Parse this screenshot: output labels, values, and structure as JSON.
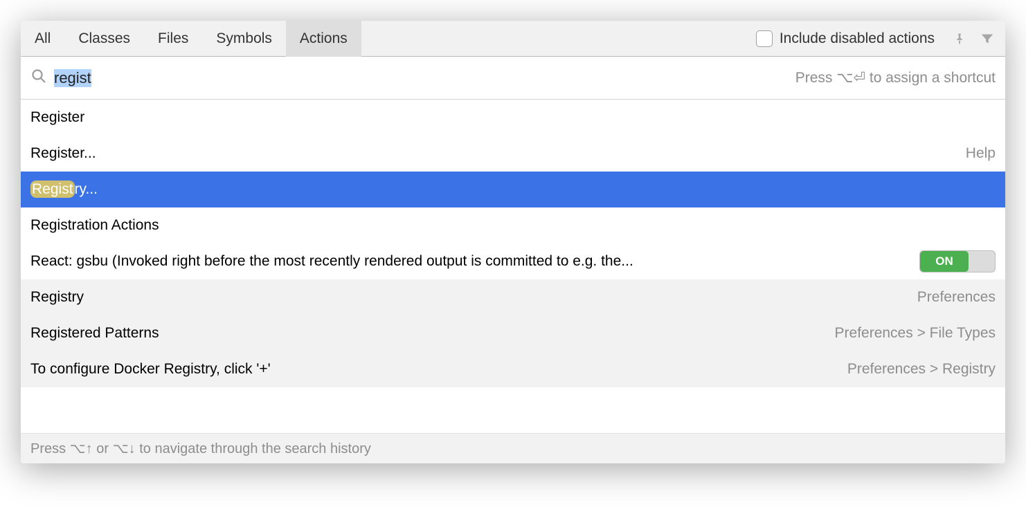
{
  "tabs": {
    "all": "All",
    "classes": "Classes",
    "files": "Files",
    "symbols": "Symbols",
    "actions": "Actions"
  },
  "checkbox": {
    "include_disabled": "Include disabled actions"
  },
  "search": {
    "value": "regist",
    "hint": "Press ⌥⏎ to assign a shortcut"
  },
  "results": [
    {
      "label_pre": "",
      "label_match": "",
      "label_rest": "Register",
      "right": "",
      "selected": false,
      "alt": false,
      "toggle": false
    },
    {
      "label_pre": "",
      "label_match": "",
      "label_rest": "Register...",
      "right": "Help",
      "selected": false,
      "alt": false,
      "toggle": false
    },
    {
      "label_pre": "",
      "label_match": "Regist",
      "label_rest": "ry...",
      "right": "",
      "selected": true,
      "alt": false,
      "toggle": false
    },
    {
      "label_pre": "",
      "label_match": "",
      "label_rest": "Registration Actions",
      "right": "",
      "selected": false,
      "alt": false,
      "toggle": false
    },
    {
      "label_pre": "",
      "label_match": "",
      "label_rest": "React: gsbu (Invoked right before the most recently rendered output is committed to e.g. the...",
      "right": "",
      "selected": false,
      "alt": false,
      "toggle": true,
      "toggle_label": "ON"
    },
    {
      "label_pre": "",
      "label_match": "",
      "label_rest": "Registry",
      "right": "Preferences",
      "selected": false,
      "alt": true,
      "toggle": false
    },
    {
      "label_pre": "",
      "label_match": "",
      "label_rest": "Registered Patterns",
      "right": "Preferences > File Types",
      "selected": false,
      "alt": true,
      "toggle": false
    },
    {
      "label_pre": "",
      "label_match": "",
      "label_rest": "To configure Docker Registry, click '+'",
      "right": "Preferences > Registry",
      "selected": false,
      "alt": true,
      "toggle": false
    }
  ],
  "footer": {
    "hint": "Press ⌥↑ or ⌥↓ to navigate through the search history"
  }
}
